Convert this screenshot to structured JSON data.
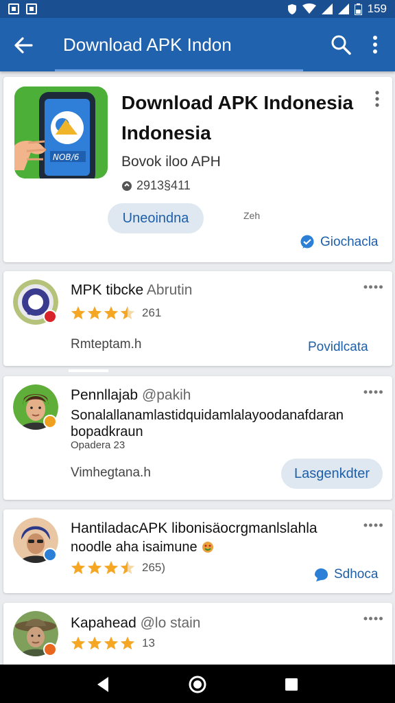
{
  "status_bar": {
    "time": "159"
  },
  "app_bar": {
    "title": "Download APK Indon"
  },
  "app_card": {
    "title": "Download APK Indonesia Indonesia",
    "subtitle": "Bovok iloo APH",
    "meta": "2913§411",
    "primary_button": "Uneoindna",
    "side_hint": "Zeh",
    "link": "Giochacla"
  },
  "reviews": [
    {
      "name": "MPK tibcke",
      "handle": "Abrutin",
      "rating": 3.5,
      "count": "261",
      "footer": "Rmteptam.h",
      "link": "Povidlcata"
    },
    {
      "name": "Pennllajab",
      "handle": "@pakih",
      "text_line1": "Sonalallanamlastidquidamlalayoodanafdaran",
      "text_line2": "bopadkraun",
      "small": "Opadera 23",
      "footer": "Vimhegtana.h",
      "button": "Lasgenkdter"
    },
    {
      "name": "HantiladacAPK libonisäocrgmanlslahla",
      "text": "noodle aha isaimune",
      "rating": 3.5,
      "count": "265)",
      "link": "Sdhoca"
    },
    {
      "name": "Kapahead",
      "handle": "@lo stain",
      "rating": 4,
      "count": "13"
    }
  ],
  "colors": {
    "primary": "#2062ad",
    "statusbar": "#1a4f92",
    "accent_link": "#1d5fa8",
    "star": "#f5a623"
  }
}
